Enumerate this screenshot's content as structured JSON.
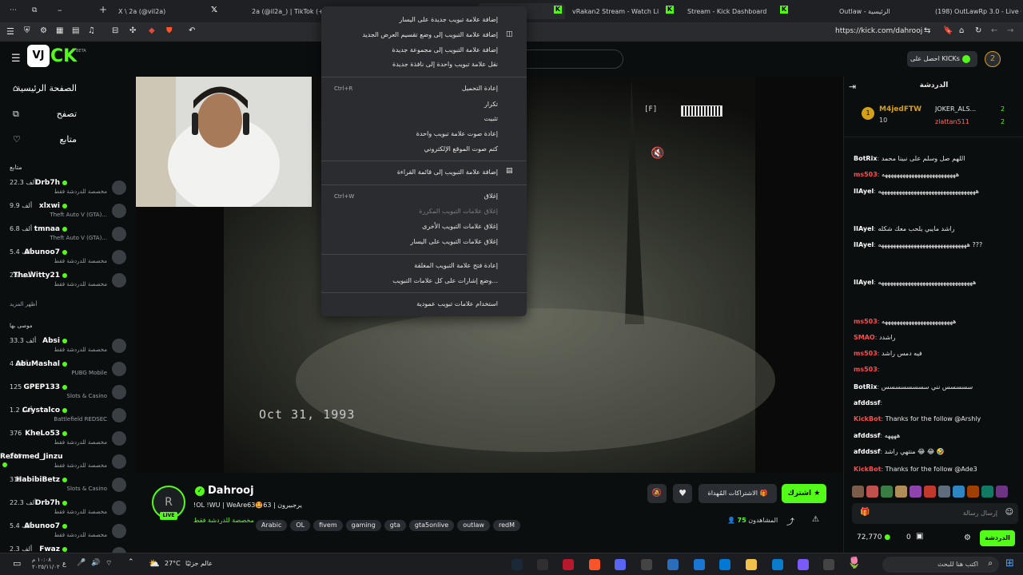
{
  "browser": {
    "tabs": [
      {
        "label": "X \\ 2a (@vil2a)"
      },
      {
        "label": "2a (@il2a_) | TikTok (+99)"
      },
      {
        "label": "vRakan2 Stream - Watch Live o"
      },
      {
        "label": "Stream - Kick Dashboard"
      },
      {
        "label": "Outlaw - الرئيسية"
      },
      {
        "label": "(198) OutLawRp 3.0 - Live Cons"
      }
    ],
    "url": "https://kick.com/dahrooj"
  },
  "context_menu": {
    "items": [
      {
        "label": "إضافة علامة تبويب جديدة على اليسار",
        "shortcut": "",
        "disabled": false
      },
      {
        "label": "إضافة علامة التبويب إلى وضع تقسيم العرض الجديد",
        "shortcut": "",
        "disabled": false
      },
      {
        "label": "إضافة علامة التبويب إلى مجموعة جديدة",
        "shortcut": "",
        "disabled": false
      },
      {
        "label": "نقل علامة تبويب واحدة إلى نافذة جديدة",
        "shortcut": "",
        "disabled": false
      },
      {
        "label": "إعادة التحميل",
        "shortcut": "Ctrl+R",
        "disabled": false
      },
      {
        "label": "تكرار",
        "shortcut": "",
        "disabled": false
      },
      {
        "label": "تثبيت",
        "shortcut": "",
        "disabled": false
      },
      {
        "label": "إعادة صوت علامة تبويب واحدة",
        "shortcut": "",
        "disabled": false
      },
      {
        "label": "كتم صوت الموقع الإلكتروني",
        "shortcut": "",
        "disabled": false
      },
      {
        "label": "إضافة علامة التبويب إلى قائمة القراءة",
        "shortcut": "",
        "disabled": false
      },
      {
        "label": "إغلاق",
        "shortcut": "Ctrl+W",
        "disabled": false
      },
      {
        "label": "إغلاق علامات التبويب المكررة",
        "shortcut": "",
        "disabled": true
      },
      {
        "label": "إغلاق علامات التبويب الأخرى",
        "shortcut": "",
        "disabled": false
      },
      {
        "label": "إغلاق علامات التبويب على اليسار",
        "shortcut": "",
        "disabled": false
      },
      {
        "label": "إعادة فتح علامة التبويب المغلقة",
        "shortcut": "",
        "disabled": false
      },
      {
        "label": "وضع إشارات على كل علامات التبويب...",
        "shortcut": "",
        "disabled": false
      },
      {
        "label": "استخدام علامات تبويب عمودية",
        "shortcut": "",
        "disabled": false
      }
    ]
  },
  "header": {
    "logo": "KICK",
    "beta": "BETA",
    "get_kicks": "احصل على KICKs",
    "kicks_count": "2"
  },
  "sidebar": {
    "nav": [
      {
        "label": "الصفحة الرئيسية",
        "icon": "home-icon"
      },
      {
        "label": "تصفح",
        "icon": "browse-icon"
      },
      {
        "label": "متابع",
        "icon": "heart-icon"
      }
    ],
    "following_title": "متابع",
    "following": [
      {
        "name": "Drb7h",
        "game": "مخصصة للدردشة فقط",
        "viewers": "22.3 ألف"
      },
      {
        "name": "xlxwi",
        "game": "Theft Auto V (GTA)...",
        "viewers": "9.9 ألف"
      },
      {
        "name": "tmnaa",
        "game": "Theft Auto V (GTA)...",
        "viewers": "6.8 ألف"
      },
      {
        "name": "Abunoo7",
        "game": "مخصصة للدردشة فقط",
        "viewers": "5.4 ألف"
      },
      {
        "name": "TheWitty21",
        "game": "مخصصة للدردشة فقط",
        "viewers": "2.9 ألف"
      }
    ],
    "show_more": "أظهر المزيد",
    "recommended_title": "موصى بها",
    "recommended": [
      {
        "name": "Absi",
        "game": "مخصصة للدردشة فقط",
        "viewers": "33.3 ألف"
      },
      {
        "name": "AbuMashal",
        "game": "PUBG Mobile",
        "viewers": "4 آلاف"
      },
      {
        "name": "GPEP133",
        "game": "Slots & Casino",
        "viewers": "125"
      },
      {
        "name": "Crystalco",
        "game": "Battlefield REDSEC",
        "viewers": "1.2 ألف"
      },
      {
        "name": "KheLo53",
        "game": "مخصصة للدردشة فقط",
        "viewers": "376"
      },
      {
        "name": "Reformed_Jinzu",
        "game": "مخصصة للدردشة فقط",
        "viewers": "215"
      },
      {
        "name": "HabibiBetz",
        "game": "Slots & Casino",
        "viewers": "318"
      },
      {
        "name": "Drb7h",
        "game": "مخصصة للدردشة فقط",
        "viewers": "22.3 ألف"
      },
      {
        "name": "Abunoo7",
        "game": "مخصصة للدردشة فقط",
        "viewers": "5.4 ألف"
      },
      {
        "name": "Fwaz",
        "game": "",
        "viewers": "2.3 ألف"
      }
    ]
  },
  "video": {
    "date_overlay": "Oct 31, 1993",
    "hud_key": "[F]"
  },
  "stream": {
    "streamer": "Dahrooj",
    "title": "!OL !WU | WeAre63🤩63 | يرجبيرون",
    "category": "مخصصة للدردشة فقط",
    "tags": [
      "Arabic",
      "OL",
      "fivem",
      "gaming",
      "gta",
      "gta5onlive",
      "outlaw",
      "redM"
    ],
    "live_badge": "LIVE",
    "subscribe_label": "اشترك",
    "gift_label": "الاشتراكات المُهداة",
    "viewers_label": "المشاهدون",
    "viewers_count": "75"
  },
  "chat": {
    "title": "الدردشة",
    "top_gifters": [
      {
        "name": "M4jedFTW",
        "count": "10"
      },
      {
        "name": "JOKER_ALS...",
        "count": "2"
      },
      {
        "name": "zlattan511",
        "count": "2"
      }
    ],
    "messages": [
      {
        "user": "BotRix",
        "text": "اللهم صل وسلم على نبينا محمد",
        "color": "#ffffff"
      },
      {
        "user": "ms503",
        "text": "هههههههههههههههههههههههههه",
        "color": "#ff4b4b"
      },
      {
        "user": "IIAyel",
        "text": "هههههههههههههههههههههههههههههههههه",
        "color": "#ffffff"
      },
      {
        "user": "IIAyel",
        "text": "راشد مايبي يلحب معك شكله",
        "color": "#ffffff"
      },
      {
        "user": "IIAyel",
        "text": "ههههههههههههههههههههههههههههههه ???",
        "color": "#ffffff"
      },
      {
        "user": "IIAyel",
        "text": "ههههههههههههههههههههههههههههههههه",
        "color": "#ffffff"
      },
      {
        "user": "ms503",
        "text": "ههههههههههههههههههههههههه",
        "color": "#ff4b4b"
      },
      {
        "user": "SMAO",
        "text": "راشدد",
        "color": "#ff4b4b"
      },
      {
        "user": "ms503",
        "text": "فيه دمس راشد",
        "color": "#ff4b4b"
      },
      {
        "user": "ms503",
        "text": "",
        "color": "#ff4b4b"
      },
      {
        "user": "BotRix",
        "text": "سسسسس نني سسسسسسسس",
        "color": "#ffffff"
      },
      {
        "user": "afddssf",
        "text": "",
        "color": "#ffffff"
      },
      {
        "user": "KickBot",
        "text": "Thanks for the follow @Arshly",
        "color": "#ff4b4b"
      },
      {
        "user": "afddssf",
        "text": "ههههه",
        "color": "#ffffff"
      },
      {
        "user": "afddssf",
        "text": "منتهي راشد 😂 😂 🤣",
        "color": "#ffffff"
      },
      {
        "user": "KickBot",
        "text": "Thanks for the follow @Ade3",
        "color": "#ff4b4b"
      }
    ],
    "input_placeholder": "إرسال رسالة",
    "points": "72,770",
    "zero": "0",
    "send_label": "الدردشة"
  },
  "taskbar": {
    "search_placeholder": "اكتب هنا للبحث",
    "weather": "27°C",
    "weather_text": "عالم جزئيًا",
    "time": "١٠:٠٨ م",
    "date": "٢٠٢٥/١١/٠٢",
    "lang": "ع"
  },
  "colors": {
    "accent": "#53fc18",
    "bg": "#0b0e0f",
    "menu_bg": "#2b2c2f"
  }
}
